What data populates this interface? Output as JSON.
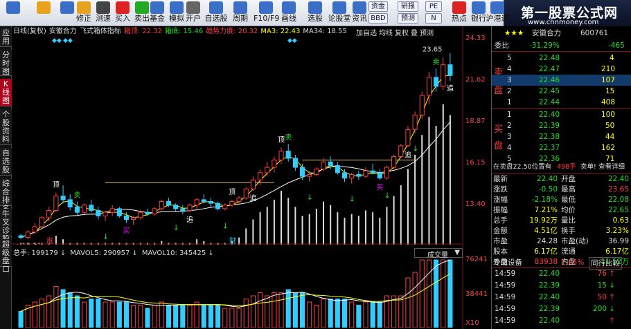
{
  "toolbar": {
    "buttons": [
      {
        "label": "",
        "icon": "grid-icon",
        "color": "#3b6fc7"
      },
      {
        "label": "",
        "icon": "arrow-left-icon",
        "color": "#e9a21d"
      },
      {
        "label": "",
        "icon": "arrows-updown-icon",
        "color": "#3b6fc7"
      },
      {
        "label": "修正",
        "icon": "smiley-icon",
        "color": "#e9a21d"
      },
      {
        "label": "测速",
        "icon": "clock-icon",
        "color": "#444"
      },
      {
        "label": "买入",
        "icon": "buy-icon",
        "color": "#d22"
      },
      {
        "label": "卖出",
        "icon": "sell-icon",
        "color": "#2a2"
      },
      {
        "label": "基金",
        "icon": "fund-icon",
        "color": "#3b6fc7"
      },
      {
        "label": "模拟",
        "icon": "money-icon",
        "color": "#3b6fc7"
      },
      {
        "label": "开户",
        "icon": "lock-icon",
        "color": "#666"
      },
      {
        "label": "自选股",
        "icon": "stock-list-icon",
        "color": "#3b6fc7"
      },
      {
        "label": "周期",
        "icon": "clock-cycle-icon",
        "color": "#3b6fc7"
      },
      {
        "label": "F10/F9",
        "icon": "f10-icon",
        "color": "#3b6fc7"
      },
      {
        "label": "画线",
        "icon": "draw-line-icon",
        "color": "#3b6fc7"
      },
      {
        "label": "选股",
        "icon": "pick-stock-icon",
        "color": "#3b6fc7"
      },
      {
        "label": "论股堂",
        "icon": "forum-icon",
        "color": "#3b6fc7"
      },
      {
        "label": "资讯",
        "icon": "news-icon",
        "color": "#3b6fc7"
      },
      {
        "label": "热点",
        "icon": "hot-icon",
        "color": "#d22"
      },
      {
        "label": "银行",
        "icon": "bank-icon",
        "color": "#3b6fc7"
      },
      {
        "label": "沪港通",
        "icon": "hk-connect-icon",
        "color": "#3b6fc7"
      }
    ],
    "small_buttons": [
      "资金",
      "BBD",
      "研报",
      "预测",
      "PE",
      "N"
    ],
    "brand_title": "第一股票公式网",
    "brand_url": "www.chnmoney.com"
  },
  "left_tabs": [
    "应用",
    "分时图",
    "K线图",
    "个股资料",
    "自选股",
    "综合排名",
    "牛叉诊股",
    "超级盘口"
  ],
  "chart": {
    "indicator_line": [
      {
        "text": "日线(复权)",
        "color": "#ddd"
      },
      {
        "text": "安徽合力",
        "color": "#ddd"
      },
      {
        "text": "飞式箱体指标",
        "color": "#ddd"
      },
      {
        "text": "箱顶: 22.32",
        "color": "#ff3b3b"
      },
      {
        "text": "箱底: 15.46",
        "color": "#1ee01e"
      },
      {
        "text": "趋势力度: 20.32",
        "color": "#ff3b3b"
      },
      {
        "text": "MA3: 22.43",
        "color": "#ff0"
      },
      {
        "text": "MA34: 18.55",
        "color": "#ddd"
      }
    ],
    "tools": [
      "加自选",
      "均线",
      "复权",
      "叠",
      "预测"
    ],
    "y_ticks": [
      "24.33",
      "21.62",
      "18.87",
      "16.15",
      "13.40"
    ],
    "high_label": "23.65",
    "low_label": "13.21",
    "markers": {
      "top": "顶",
      "sell": "卖",
      "buy": "买",
      "chase": "追",
      "rise": "涨",
      "finance": "财"
    },
    "volume_title": [
      {
        "text": "总手: 199179",
        "color": "#ddd"
      },
      {
        "text": "MAVOL5: 290957",
        "color": "#ddd"
      },
      {
        "text": "MAVOL10: 345425",
        "color": "#ddd"
      }
    ],
    "volume_button": "成交量",
    "vol_ticks": [
      "76241",
      "38441",
      "X10"
    ]
  },
  "chart_data": {
    "type": "candlestick",
    "title": "安徽合力",
    "ylim": [
      13.0,
      24.6
    ],
    "series": [
      {
        "name": "K线",
        "ohlc": [
          [
            13.5,
            13.6,
            13.3,
            13.4
          ],
          [
            13.4,
            13.8,
            13.3,
            13.7
          ],
          [
            13.7,
            14.2,
            13.6,
            14.0
          ],
          [
            14.0,
            14.6,
            13.9,
            14.5
          ],
          [
            14.5,
            15.1,
            14.3,
            14.9
          ],
          [
            14.9,
            15.9,
            14.8,
            15.7
          ],
          [
            15.7,
            16.3,
            15.3,
            15.5
          ],
          [
            15.5,
            15.8,
            14.9,
            15.1
          ],
          [
            15.1,
            15.4,
            14.6,
            14.8
          ],
          [
            14.8,
            15.3,
            14.7,
            15.2
          ],
          [
            15.2,
            15.5,
            14.8,
            14.9
          ],
          [
            14.9,
            15.1,
            14.4,
            14.6
          ],
          [
            14.6,
            14.9,
            14.3,
            14.8
          ],
          [
            14.8,
            15.2,
            14.6,
            15.0
          ],
          [
            15.0,
            15.1,
            14.5,
            14.6
          ],
          [
            14.6,
            14.8,
            14.2,
            14.4
          ],
          [
            14.4,
            14.6,
            14.1,
            14.5
          ],
          [
            14.5,
            14.9,
            14.4,
            14.8
          ],
          [
            14.8,
            15.0,
            14.6,
            14.7
          ],
          [
            14.7,
            15.1,
            14.6,
            15.0
          ],
          [
            15.0,
            15.5,
            14.9,
            15.4
          ],
          [
            15.4,
            15.6,
            15.1,
            15.2
          ],
          [
            15.2,
            15.3,
            14.8,
            15.0
          ],
          [
            15.0,
            15.2,
            14.7,
            14.9
          ],
          [
            14.9,
            15.3,
            14.8,
            15.2
          ],
          [
            15.2,
            15.6,
            15.0,
            15.5
          ],
          [
            15.5,
            15.8,
            15.3,
            15.4
          ],
          [
            15.4,
            15.6,
            15.1,
            15.3
          ],
          [
            15.3,
            15.4,
            14.9,
            15.0
          ],
          [
            15.0,
            15.3,
            14.9,
            15.2
          ],
          [
            15.2,
            15.5,
            15.1,
            15.4
          ],
          [
            15.4,
            15.7,
            15.3,
            15.6
          ],
          [
            15.6,
            16.2,
            15.5,
            16.1
          ],
          [
            16.1,
            16.8,
            16.0,
            16.6
          ],
          [
            16.6,
            17.2,
            16.3,
            17.0
          ],
          [
            17.0,
            17.6,
            16.8,
            17.3
          ],
          [
            17.3,
            17.9,
            17.0,
            17.7
          ],
          [
            17.7,
            18.4,
            17.5,
            18.2
          ],
          [
            18.2,
            18.6,
            17.6,
            17.8
          ],
          [
            17.8,
            18.0,
            17.1,
            17.3
          ],
          [
            17.3,
            17.5,
            16.6,
            16.8
          ],
          [
            16.8,
            17.1,
            16.5,
            16.9
          ],
          [
            16.9,
            17.3,
            16.8,
            17.2
          ],
          [
            17.2,
            17.8,
            17.1,
            17.6
          ],
          [
            17.6,
            17.9,
            17.2,
            17.4
          ],
          [
            17.4,
            17.6,
            16.9,
            17.0
          ],
          [
            17.0,
            17.2,
            16.5,
            16.7
          ],
          [
            16.7,
            17.0,
            16.4,
            16.9
          ],
          [
            16.9,
            17.1,
            16.6,
            16.8
          ],
          [
            16.8,
            17.3,
            16.7,
            17.1
          ],
          [
            17.1,
            17.5,
            16.9,
            17.0
          ],
          [
            17.0,
            17.2,
            16.6,
            16.7
          ],
          [
            16.7,
            17.4,
            16.6,
            17.3
          ],
          [
            17.3,
            18.0,
            17.2,
            17.9
          ],
          [
            17.9,
            18.6,
            17.8,
            18.5
          ],
          [
            18.5,
            19.6,
            18.4,
            19.4
          ],
          [
            19.4,
            20.4,
            19.2,
            20.2
          ],
          [
            20.2,
            21.5,
            20.0,
            21.3
          ],
          [
            21.3,
            22.6,
            20.8,
            22.3
          ],
          [
            22.3,
            22.8,
            21.5,
            21.8
          ],
          [
            21.8,
            23.4,
            21.6,
            23.0
          ],
          [
            23.0,
            23.65,
            22.1,
            22.4
          ]
        ]
      }
    ]
  },
  "quote": {
    "header_name": "安徽合力",
    "header_code": "600761",
    "weibi_label": "委比",
    "weibi_pct": "-31.29%",
    "weibi_diff": "-465",
    "sell_side_label_1": "卖",
    "sell_side_label_2": "盘",
    "buy_side_label_1": "买",
    "buy_side_label_2": "盘",
    "asks": [
      {
        "n": "5",
        "price": "22.48",
        "vol": "4"
      },
      {
        "n": "4",
        "price": "22.47",
        "vol": "210"
      },
      {
        "n": "3",
        "price": "22.46",
        "vol": "107"
      },
      {
        "n": "2",
        "price": "22.45",
        "vol": "15"
      },
      {
        "n": "1",
        "price": "22.44",
        "vol": "408"
      }
    ],
    "bids": [
      {
        "n": "1",
        "price": "22.40",
        "vol": "100"
      },
      {
        "n": "2",
        "price": "22.39",
        "vol": "50"
      },
      {
        "n": "3",
        "price": "22.38",
        "vol": "44"
      },
      {
        "n": "4",
        "price": "22.37",
        "vol": "162"
      },
      {
        "n": "5",
        "price": "22.36",
        "vol": "71"
      }
    ],
    "pending": {
      "left": "在卖盘22.50位置有",
      "mid": "498手",
      "sell1": "卖单!",
      "detail": "查看详细"
    },
    "stats": [
      {
        "l1": "最新",
        "v1": "22.40",
        "c1": "green",
        "l2": "开盘",
        "v2": "22.40",
        "c2": "green"
      },
      {
        "l1": "涨跌",
        "v1": "-0.50",
        "c1": "green",
        "l2": "最高",
        "v2": "23.65",
        "c2": "red"
      },
      {
        "l1": "涨幅",
        "v1": "-2.18%",
        "c1": "green",
        "l2": "最低",
        "v2": "22.08",
        "c2": "green"
      },
      {
        "l1": "振幅",
        "v1": "7.21%",
        "c1": "yellow",
        "l2": "均价",
        "v2": "22.65",
        "c2": "green"
      },
      {
        "l1": "总手",
        "v1": "19.92万",
        "c1": "yellow",
        "l2": "量比",
        "v2": "0.63",
        "c2": "yellow"
      },
      {
        "l1": "金额",
        "v1": "4.51亿",
        "c1": "yellow",
        "l2": "换手",
        "v2": "3.23%",
        "c2": "yellow"
      },
      {
        "l1": "市盈",
        "v1": "24.28",
        "c1": "white",
        "l2": "市盈(动)",
        "v2": "36.99",
        "c2": "white"
      },
      {
        "l1": "股本",
        "v1": "6.17亿",
        "c1": "yellow",
        "l2": "流通",
        "v2": "6.17亿",
        "c2": "yellow"
      },
      {
        "l1": "外盘",
        "v1": "83938",
        "c1": "red",
        "l2": "内盘",
        "v2": "11.52万",
        "c2": "green"
      }
    ],
    "industry": {
      "label": "专用设备",
      "pct": "1.45%",
      "compare": "同行比较"
    },
    "ticks": [
      {
        "time": "14:59",
        "price": "22.40",
        "vol": "76",
        "dir": "up"
      },
      {
        "time": "14:59",
        "price": "22.39",
        "vol": "15",
        "dir": "down"
      },
      {
        "time": "14:59",
        "price": "22.40",
        "vol": "50",
        "dir": "up"
      },
      {
        "time": "14:59",
        "price": "22.39",
        "vol": "200",
        "dir": "down"
      },
      {
        "time": "14:59",
        "price": "22.40",
        "vol": "",
        "dir": "up"
      }
    ]
  }
}
